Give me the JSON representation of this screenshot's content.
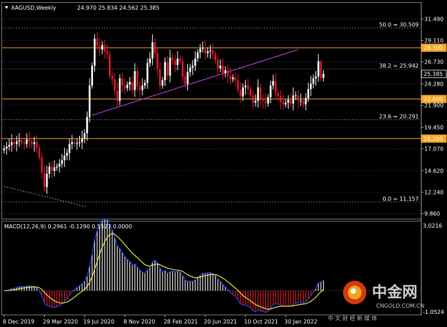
{
  "header": {
    "symbol_tf": "XAGUSD,Weekly",
    "ohlc": "24.970 25.834 24.562 25.385"
  },
  "macd": {
    "label": "MACD(12,26,9) 0.2961 -0.1290 0.5527 0.0000",
    "top_tick": "3.0216",
    "bottom_tick": "-1.0524"
  },
  "fib_labels": [
    "50.0 = 30.509",
    "38.2 = 25.942",
    "23.6 = 20.291",
    "0.0 = 11.157"
  ],
  "watermark": {
    "cn_title": "中金网",
    "url": "CNGOLD.COM.CN",
    "slogan": "中 文 财 经 新 媒 体"
  },
  "colors": {
    "bull": "#ffffff",
    "bear": "#e0192c",
    "level_line": "#f5a623",
    "trendline": "#b23bd6",
    "macd_line": "#2346ff",
    "signal_line": "#ffff3a",
    "grid": "#555555"
  },
  "chart_data": [
    {
      "type": "candlestick",
      "title": "XAGUSD,Weekly",
      "x_ticks": [
        "8 Dec 2019",
        "29 Mar 2020",
        "19 Jul 2020",
        "8 Nov 2020",
        "28 Feb 2021",
        "20 Jun 2021",
        "10 Oct 2021",
        "30 Jan 2022"
      ],
      "y_ticks": [
        "31.490",
        "29.110",
        "26.730",
        "24.280",
        "21.900",
        "19.450",
        "17.070",
        "14.620",
        "12.240",
        "9.860"
      ],
      "ylim": [
        9.3,
        33.3
      ],
      "price_tags": [
        {
          "label": "28.300",
          "value": 28.3,
          "kind": "level"
        },
        {
          "label": "25.385",
          "value": 25.385,
          "kind": "current"
        },
        {
          "label": "22.600",
          "value": 22.6,
          "kind": "level"
        },
        {
          "label": "18.200",
          "value": 18.2,
          "kind": "level"
        }
      ],
      "horizontal_levels": [
        28.3,
        22.6,
        18.2
      ],
      "fib_levels": [
        30.509,
        25.942,
        20.291,
        11.157
      ],
      "trendline": {
        "from": {
          "week": 35,
          "price": 20.8
        },
        "to": {
          "week": 117,
          "price": 28.1
        }
      },
      "dashed_trendline": {
        "from": {
          "week": 0,
          "price": 12.9
        },
        "to": {
          "week": 33,
          "price": 10.6
        }
      },
      "close": [
        17.1,
        17.3,
        17.5,
        17.8,
        17.6,
        17.9,
        18.0,
        17.8,
        17.6,
        18.1,
        17.9,
        17.6,
        17.8,
        17.2,
        16.1,
        14.4,
        12.8,
        14.3,
        15.1,
        14.6,
        15.0,
        15.1,
        15.4,
        15.8,
        16.3,
        16.6,
        17.6,
        17.8,
        17.6,
        17.7,
        17.8,
        18.2,
        18.8,
        20.6,
        24.1,
        26.3,
        29.3,
        28.5,
        28.1,
        28.6,
        27.9,
        27.6,
        25.2,
        24.8,
        23.5,
        22.4,
        24.9,
        24.1,
        23.8,
        24.2,
        24.5,
        23.6,
        25.7,
        24.0,
        23.6,
        24.1,
        24.4,
        26.6,
        27.1,
        28.9,
        27.7,
        25.9,
        24.1,
        24.7,
        26.7,
        25.2,
        27.2,
        26.9,
        26.4,
        27.1,
        26.8,
        25.1,
        24.3,
        25.6,
        26.1,
        26.3,
        27.1,
        27.8,
        28.2,
        28.3,
        27.7,
        27.9,
        28.0,
        27.6,
        26.9,
        26.0,
        26.3,
        25.5,
        25.8,
        25.2,
        24.8,
        25.0,
        24.7,
        23.6,
        22.9,
        23.9,
        24.1,
        23.7,
        23.0,
        22.2,
        22.4,
        23.9,
        22.5,
        22.4,
        22.1,
        22.8,
        24.1,
        24.6,
        23.3,
        22.9,
        22.3,
        22.0,
        22.2,
        22.5,
        22.1,
        23.0,
        23.0,
        22.4,
        22.4,
        22.0,
        22.7,
        23.7,
        24.3,
        24.9,
        25.1,
        26.8,
        24.9,
        25.4
      ],
      "open_last": 24.97,
      "high_last": 25.834,
      "low_last": 24.562
    },
    {
      "type": "macd",
      "title": "MACD(12,26,9)",
      "params": [
        12,
        26,
        9
      ],
      "values": {
        "main": 0.2961,
        "signal": -0.129,
        "histogram": 0.5527,
        "extra": 0.0
      },
      "ylim": [
        -1.0524,
        3.0216
      ]
    }
  ]
}
